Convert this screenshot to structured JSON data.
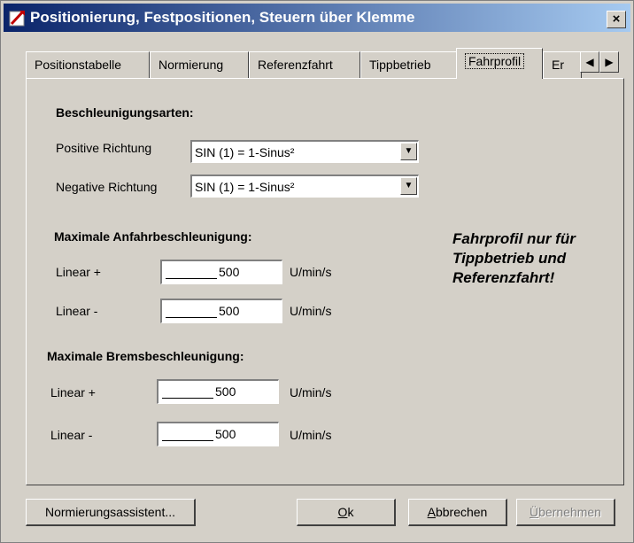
{
  "window": {
    "title": "Positionierung, Festpositionen, Steuern über Klemme",
    "close_glyph": "×"
  },
  "tabs": [
    {
      "label": "Positionstabelle"
    },
    {
      "label": "Normierung"
    },
    {
      "label": "Referenzfahrt"
    },
    {
      "label": "Tippbetrieb"
    },
    {
      "label": "Fahrprofil"
    },
    {
      "label": "Er"
    }
  ],
  "tab_scroll": {
    "left": "◀",
    "right": "▶"
  },
  "accel_types": {
    "header": "Beschleunigungsarten:",
    "positive_label": "Positive Richtung",
    "positive_value": "SIN (1) = 1-Sinus²",
    "negative_label": "Negative Richtung",
    "negative_value": "SIN (1) = 1-Sinus²",
    "dropdown_glyph": "▼"
  },
  "max_start": {
    "header": "Maximale Anfahrbeschleunigung:",
    "linear_plus_label": "Linear +",
    "linear_plus_value": "500",
    "linear_minus_label": "Linear -",
    "linear_minus_value": "500",
    "unit": "U/min/s"
  },
  "max_brake": {
    "header": "Maximale Bremsbeschleunigung:",
    "linear_plus_label": "Linear +",
    "linear_plus_value": "500",
    "linear_minus_label": "Linear -",
    "linear_minus_value": "500",
    "unit": "U/min/s"
  },
  "note": "Fahrprofil nur für\nTippbetrieb und\nReferenzfahrt!",
  "buttons": {
    "assistant": "Normierungsassistent...",
    "ok_mnemonic": "O",
    "ok_rest": "k",
    "cancel_mnemonic": "A",
    "cancel_rest": "bbrechen",
    "apply_mnemonic": "Ü",
    "apply_rest": "bernehmen"
  },
  "colors": {
    "title_start": "#0a246a",
    "title_end": "#a6caf0",
    "face": "#d4d0c8"
  }
}
